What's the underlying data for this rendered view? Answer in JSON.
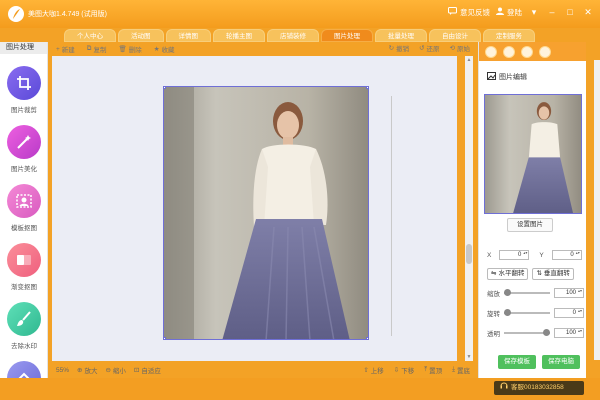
{
  "window": {
    "title": "美图大咖1.4.749 (试用版)",
    "feedback_label": "意见反馈",
    "login_label": "登陆"
  },
  "tabs": [
    {
      "label": "个人中心",
      "active": false
    },
    {
      "label": "活动图",
      "active": false
    },
    {
      "label": "详情图",
      "active": false
    },
    {
      "label": "轮播主图",
      "active": false
    },
    {
      "label": "店铺装修",
      "active": false
    },
    {
      "label": "图片处理",
      "active": true
    },
    {
      "label": "批量处理",
      "active": false
    },
    {
      "label": "自由设计",
      "active": false
    },
    {
      "label": "定制服务",
      "active": false
    }
  ],
  "sidebar": {
    "title": "图片处理",
    "items": [
      {
        "label": "图片裁剪",
        "icon": "crop-icon",
        "color": "#6a5adf"
      },
      {
        "label": "图片美化",
        "icon": "magic-wand-icon",
        "color": "#d94ad0"
      },
      {
        "label": "模板抠图",
        "icon": "cutout-icon",
        "color": "#e861c8"
      },
      {
        "label": "渐变抠图",
        "icon": "gradient-icon",
        "color": "#f2708a"
      },
      {
        "label": "去除水印",
        "icon": "brush-icon",
        "color": "#3fc8a2"
      },
      {
        "label": "",
        "icon": "more-icon",
        "color": "#7a7ae0"
      }
    ]
  },
  "toolbar": {
    "new_label": "新建",
    "copy_label": "复制",
    "delete_label": "删除",
    "favorite_label": "收藏",
    "redo_label": "撤销",
    "undo_label": "还原",
    "original_label": "原始"
  },
  "bottom_bar": {
    "zoom_value": "55%",
    "zoom_in_label": "放大",
    "zoom_out_label": "缩小",
    "fit_label": "自适应",
    "move_up_label": "上移",
    "move_down_label": "下移",
    "to_top_label": "置顶",
    "to_bottom_label": "置底"
  },
  "panel": {
    "section_title": "图片编辑",
    "set_image_label": "设置图片",
    "x_label": "X",
    "x_value": "0",
    "y_label": "Y",
    "y_value": "0",
    "flip_h_label": "水平翻转",
    "flip_v_label": "垂直翻转",
    "scale_label": "缩放",
    "scale_value": "100",
    "rotate_label": "旋转",
    "rotate_value": "0",
    "opacity_label": "透明",
    "opacity_value": "100",
    "save_template_label": "保存模板",
    "save_pc_label": "保存电脑"
  },
  "statusbar": {
    "service_label": "客服00183032858"
  },
  "colors": {
    "accent": "#f39e22",
    "selection": "#6f6fd6",
    "save_green": "#4fc05d"
  }
}
